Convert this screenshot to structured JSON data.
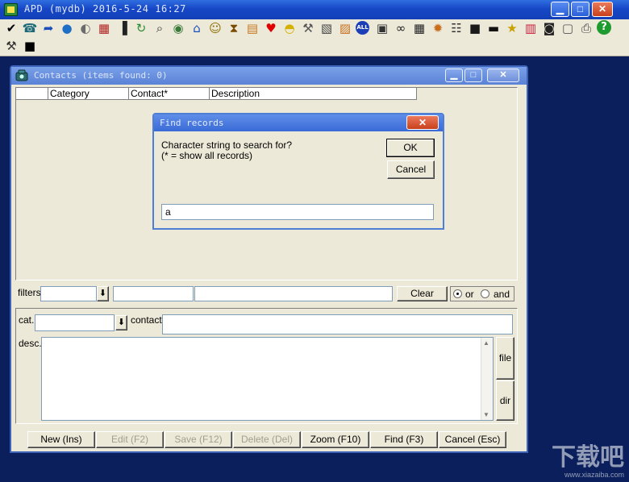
{
  "main_window": {
    "title": "APD (mydb) 2016-5-24 16:27",
    "caption_buttons": {
      "minimize": "▁",
      "maximize": "□",
      "close": "✕"
    }
  },
  "toolbar": {
    "icons": [
      {
        "name": "check-icon",
        "glyph": "✔",
        "color": "#000000"
      },
      {
        "name": "phone-icon",
        "glyph": "☎",
        "color": "#1d6a7a"
      },
      {
        "name": "arrow-redo-icon",
        "glyph": "➦",
        "color": "#1c4fb8"
      },
      {
        "name": "globe-icon",
        "glyph": "●",
        "color": "#1f6fc7"
      },
      {
        "name": "money-bag-icon",
        "glyph": "◐",
        "color": "#6b6b6b"
      },
      {
        "name": "calendar-icon",
        "glyph": "▦",
        "color": "#b22222"
      },
      {
        "name": "chart-icon",
        "glyph": "▐",
        "color": "#222222"
      },
      {
        "name": "clock-refresh-icon",
        "glyph": "↻",
        "color": "#2e8b2e"
      },
      {
        "name": "book-search-icon",
        "glyph": "⌕",
        "color": "#333333"
      },
      {
        "name": "globe-pin-icon",
        "glyph": "◉",
        "color": "#3a7a3a"
      },
      {
        "name": "bank-icon",
        "glyph": "⌂",
        "color": "#1c4fb8"
      },
      {
        "name": "smiley-icon",
        "glyph": "☺",
        "color": "#8b6b00"
      },
      {
        "name": "hourglass-icon",
        "glyph": "⧗",
        "color": "#7a4b00"
      },
      {
        "name": "folder-icon",
        "glyph": "▤",
        "color": "#c8781e"
      },
      {
        "name": "heart-icon",
        "glyph": "♥",
        "color": "#e00000"
      },
      {
        "name": "lightbulb-icon",
        "glyph": "◓",
        "color": "#d4b000"
      },
      {
        "name": "wrench-icon",
        "glyph": "⚒",
        "color": "#555555"
      },
      {
        "name": "calculator-icon",
        "glyph": "▧",
        "color": "#444444"
      },
      {
        "name": "notebook-icon",
        "glyph": "▨",
        "color": "#c86e1e"
      },
      {
        "name": "all-icon",
        "glyph": "ALL",
        "color": "#1c3fb8"
      },
      {
        "name": "address-book-icon",
        "glyph": "▣",
        "color": "#333333"
      },
      {
        "name": "binoculars-icon",
        "glyph": "∞",
        "color": "#222222"
      },
      {
        "name": "table-icon",
        "glyph": "▦",
        "color": "#222222"
      },
      {
        "name": "grid-star-icon",
        "glyph": "✹",
        "color": "#c86e1e"
      },
      {
        "name": "network-icon",
        "glyph": "☷",
        "color": "#333333"
      },
      {
        "name": "screen-icon",
        "glyph": "■",
        "color": "#1a1a1a"
      },
      {
        "name": "card-icon",
        "glyph": "▬",
        "color": "#111111"
      },
      {
        "name": "sticky-note-icon",
        "glyph": "★",
        "color": "#c8a000"
      },
      {
        "name": "archive-icon",
        "glyph": "▥",
        "color": "#c81e3c"
      },
      {
        "name": "camera-icon",
        "glyph": "◙",
        "color": "#222222"
      },
      {
        "name": "lock-icon",
        "glyph": "▢",
        "color": "#555555"
      },
      {
        "name": "printer-icon",
        "glyph": "⎙",
        "color": "#444444"
      },
      {
        "name": "help-icon",
        "glyph": "?",
        "color": "#ffffff"
      },
      {
        "name": "tools-icon",
        "glyph": "⚒",
        "color": "#333333"
      },
      {
        "name": "terminal-icon",
        "glyph": "■",
        "color": "#000000"
      }
    ]
  },
  "contacts_window": {
    "title": "Contacts (items found: 0)",
    "caption_buttons": {
      "minimize": "▁",
      "maximize": "□",
      "close": "✕"
    },
    "columns": [
      "",
      "Category",
      "Contact*",
      "Description"
    ],
    "filters": {
      "label": "filters",
      "dropdown_arrow": "⬇",
      "clear_label": "Clear",
      "or_label": "or",
      "and_label": "and"
    },
    "detail": {
      "cat_label": "cat.",
      "contact_label": "contact",
      "desc_label": "desc.",
      "file_label": "file",
      "dir_label": "dir",
      "scroll_up": "▲",
      "scroll_down": "▼"
    },
    "bottom_buttons": {
      "new": "New (Ins)",
      "edit": "Edit (F2)",
      "save": "Save (F12)",
      "delete": "Delete (Del)",
      "zoom": "Zoom (F10)",
      "find": "Find (F3)",
      "cancel": "Cancel (Esc)"
    }
  },
  "find_dialog": {
    "title": "Find records",
    "close": "✕",
    "prompt_line1": "Character string to search for?",
    "prompt_line2": "(* = show all records)",
    "ok_label": "OK",
    "cancel_label": "Cancel",
    "search_value": "a"
  },
  "watermark": {
    "line1": "下载吧",
    "line2": "www.xiazaiba.com"
  }
}
